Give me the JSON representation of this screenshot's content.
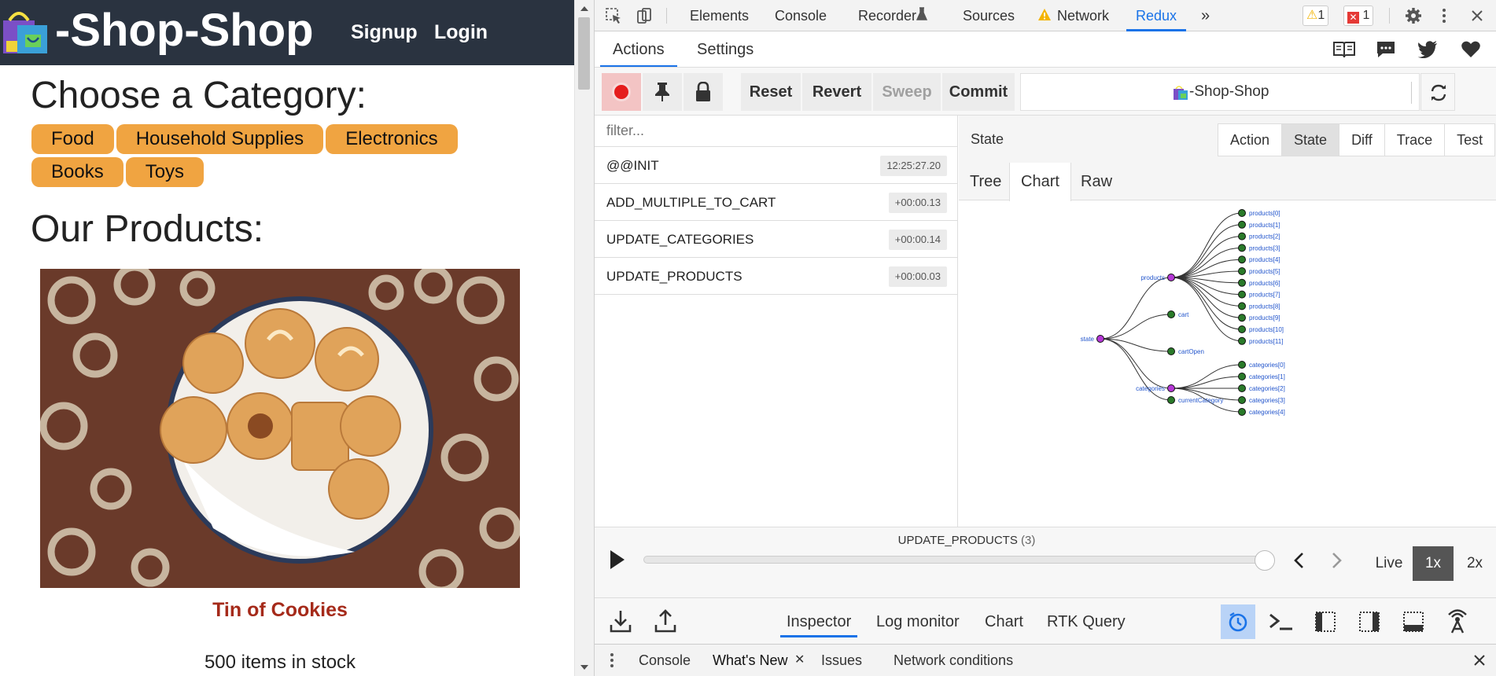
{
  "shop": {
    "title": "-Shop-Shop",
    "nav": {
      "signup": "Signup",
      "login": "Login"
    },
    "category_heading": "Choose a Category:",
    "categories": [
      "Food",
      "Household Supplies",
      "Electronics",
      "Books",
      "Toys"
    ],
    "products_heading": "Our Products:",
    "product": {
      "name": "Tin of Cookies",
      "stock": "500 items in stock"
    }
  },
  "devtools": {
    "tabs": [
      "Elements",
      "Console",
      "Recorder",
      "Sources",
      "Network",
      "Redux"
    ],
    "active_tab": "Redux",
    "warnings_count": "1",
    "errors_count": "1"
  },
  "redux": {
    "subtabs": {
      "actions": "Actions",
      "settings": "Settings"
    },
    "toolbar": {
      "reset": "Reset",
      "revert": "Revert",
      "sweep": "Sweep",
      "commit": "Commit"
    },
    "instance_name": "-Shop-Shop",
    "filter_placeholder": "filter...",
    "actions": [
      {
        "name": "@@INIT",
        "time": "12:25:27.20"
      },
      {
        "name": "ADD_MULTIPLE_TO_CART",
        "time": "+00:00.13"
      },
      {
        "name": "UPDATE_CATEGORIES",
        "time": "+00:00.14"
      },
      {
        "name": "UPDATE_PRODUCTS",
        "time": "+00:00.03"
      }
    ],
    "state_title": "State",
    "modes": [
      "Action",
      "State",
      "Diff",
      "Trace",
      "Test"
    ],
    "active_mode": "State",
    "views": [
      "Tree",
      "Chart",
      "Raw"
    ],
    "active_view": "Chart",
    "tree": {
      "root": "state",
      "branches": [
        "products",
        "cart",
        "cartOpen",
        "categories",
        "currentCategory"
      ],
      "products": [
        "products[0]",
        "products[1]",
        "products[2]",
        "products[3]",
        "products[4]",
        "products[5]",
        "products[6]",
        "products[7]",
        "products[8]",
        "products[9]",
        "products[10]",
        "products[11]"
      ],
      "categories": [
        "categories[0]",
        "categories[1]",
        "categories[2]",
        "categories[3]",
        "categories[4]"
      ]
    },
    "slider": {
      "label": "UPDATE_PRODUCTS",
      "count": "(3)",
      "position": 1.0
    },
    "speeds": {
      "live": "Live",
      "x1": "1x",
      "x2": "2x"
    },
    "monitors": [
      "Inspector",
      "Log monitor",
      "Chart",
      "RTK Query"
    ],
    "active_monitor": "Inspector"
  },
  "drawer": {
    "tabs": [
      "Console",
      "What's New",
      "Issues",
      "Network conditions"
    ],
    "active": "What's New"
  },
  "colors": {
    "shop_header": "#2a3340",
    "category_button": "#f0a441",
    "product_name": "#a52a1a",
    "accent": "#1a73e8",
    "node_parent": "#b537d6",
    "node_leaf": "#2a7a2a",
    "node_label": "#2255cc"
  }
}
